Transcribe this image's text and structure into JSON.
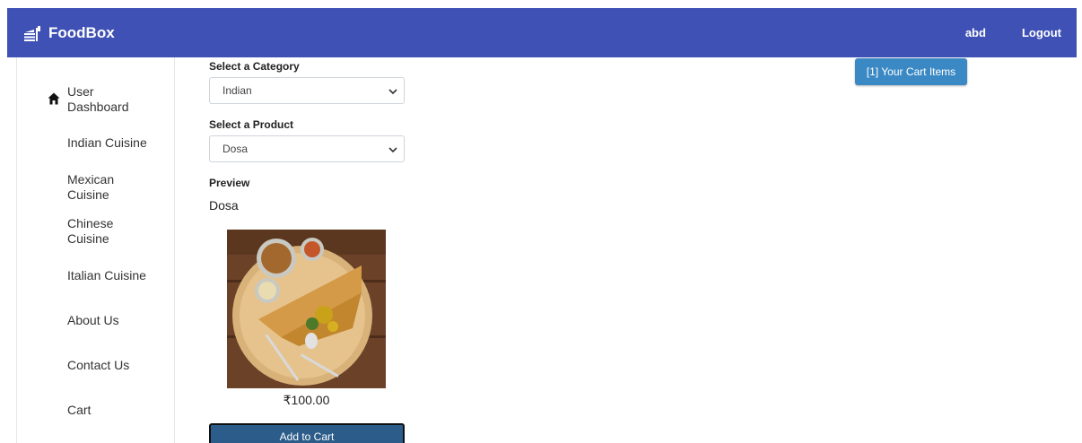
{
  "header": {
    "brand": "FoodBox",
    "user": "abd",
    "logout": "Logout",
    "background": "#3f51b5"
  },
  "sidebar": {
    "items": [
      {
        "label": "User Dashboard",
        "icon": "home-icon"
      },
      {
        "label": "Indian Cuisine"
      },
      {
        "label": "Mexican Cuisine"
      },
      {
        "label": "Chinese Cuisine"
      },
      {
        "label": "Italian Cuisine"
      },
      {
        "label": "About Us"
      },
      {
        "label": "Contact Us"
      },
      {
        "label": "Cart"
      }
    ]
  },
  "form": {
    "category_label": "Select a Category",
    "category_value": "Indian",
    "product_label": "Select a Product",
    "product_value": "Dosa",
    "preview_label": "Preview",
    "preview_name": "Dosa",
    "price": "₹100.00",
    "add_to_cart": "Add to Cart"
  },
  "cart": {
    "badge": "[1] Your Cart Items"
  }
}
